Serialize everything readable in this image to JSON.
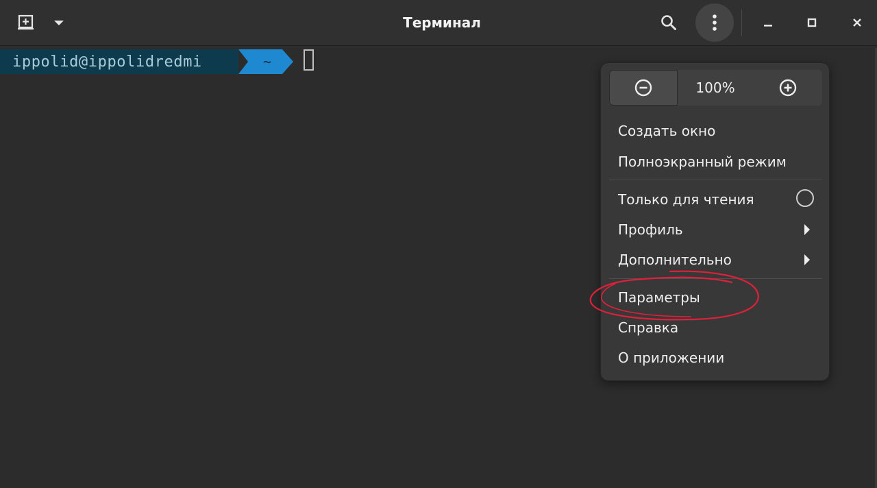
{
  "window": {
    "title": "Терминал"
  },
  "terminal": {
    "prompt_user": "ippolid@ippolidredmi",
    "prompt_dir": "~"
  },
  "menu": {
    "zoom": {
      "value": "100%"
    },
    "items": [
      {
        "label": "Создать окно"
      },
      {
        "label": "Полноэкранный режим"
      },
      {
        "label": "Только для чтения"
      },
      {
        "label": "Профиль"
      },
      {
        "label": "Дополнительно"
      },
      {
        "label": "Параметры"
      },
      {
        "label": "Справка"
      },
      {
        "label": "О приложении"
      }
    ]
  },
  "icons": {
    "new_tab": "new-tab-icon",
    "tab_dropdown": "chevron-down-icon",
    "search": "search-icon",
    "menu": "kebab-menu-icon",
    "minimize": "minimize-icon",
    "maximize": "maximize-icon",
    "close": "close-icon",
    "zoom_out": "zoom-out-icon",
    "zoom_in": "zoom-in-icon"
  },
  "colors": {
    "prompt_user_bg": "#0e3a4d",
    "prompt_dir_bg": "#1e88d0",
    "annotation": "#e0203a"
  }
}
